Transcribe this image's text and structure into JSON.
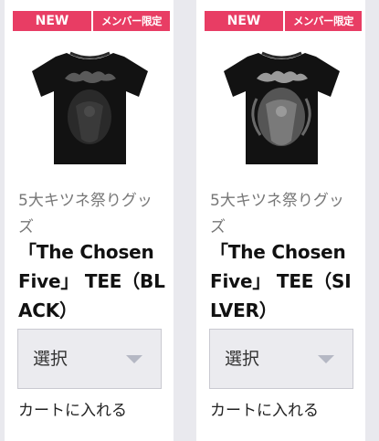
{
  "products": [
    {
      "badges": {
        "new": "NEW",
        "member": "メンバー限定"
      },
      "category": "5大キツネ祭りグッズ",
      "title": "「The Chosen Five」 TEE（BLACK）",
      "variant": "black",
      "select": {
        "value": "選択"
      },
      "cart_label": "カートに入れる"
    },
    {
      "badges": {
        "new": "NEW",
        "member": "メンバー限定"
      },
      "category": "5大キツネ祭りグッズ",
      "title": "「The Chosen Five」 TEE（SILVER）",
      "variant": "silver",
      "select": {
        "value": "選択"
      },
      "cart_label": "カートに入れる"
    }
  ],
  "colors": {
    "badge": "#e83d64",
    "shirt": "#121212",
    "silver_print": "#8a8a8a",
    "background": "#e9e9ee"
  }
}
